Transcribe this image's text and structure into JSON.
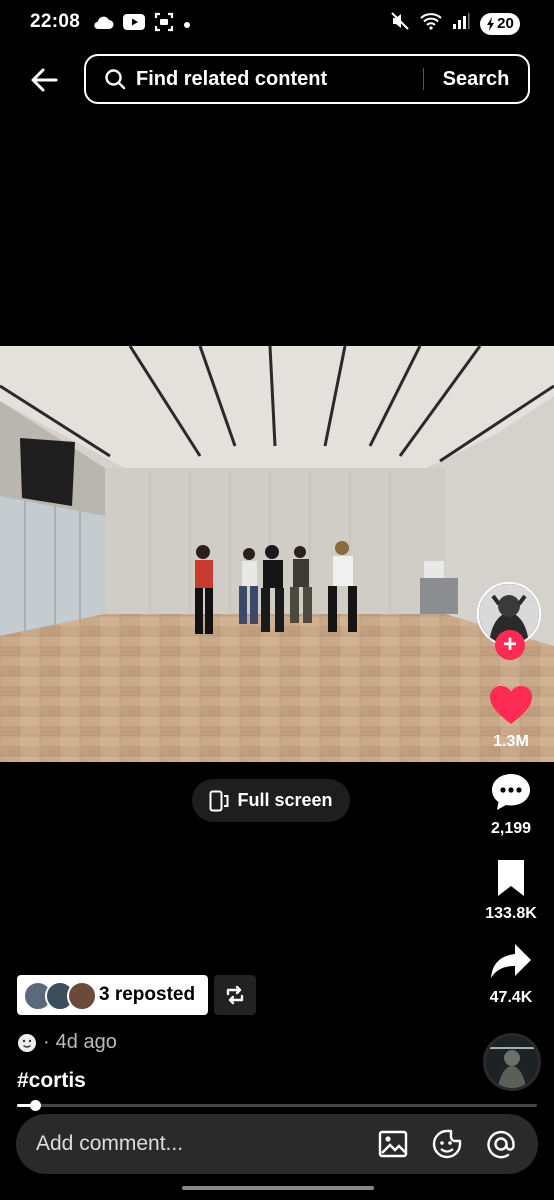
{
  "status_bar": {
    "time": "22:08",
    "battery": "20",
    "left_icons": [
      "cloud-icon",
      "youtube-icon",
      "screen-record-icon",
      "dot-icon"
    ],
    "right_icons": [
      "mute-icon",
      "wifi-icon",
      "signal-icon",
      "battery-icon"
    ]
  },
  "header": {
    "search_placeholder": "Find related content",
    "search_button": "Search"
  },
  "video": {
    "progress": 0.035
  },
  "fullscreen_label": "Full screen",
  "actions": {
    "likes": "1.3M",
    "comments": "2,199",
    "saves": "133.8K",
    "shares": "47.4K"
  },
  "repost": {
    "label": "3 reposted"
  },
  "meta": {
    "time_ago": "4d ago"
  },
  "caption": {
    "hashtag": "#cortis"
  },
  "comment": {
    "placeholder": "Add comment..."
  },
  "colors": {
    "accent": "#fe2c55",
    "background": "#000000",
    "comment_bar": "#2a2a2a"
  }
}
